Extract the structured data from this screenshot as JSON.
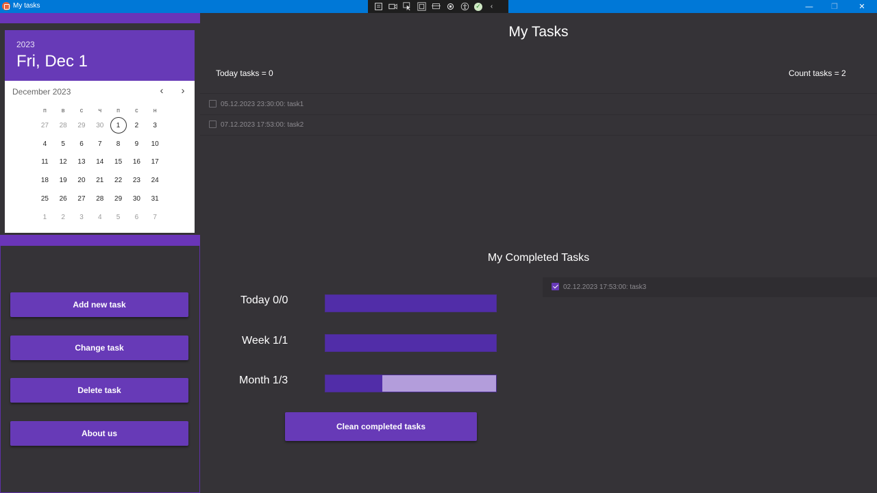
{
  "window": {
    "title": "My tasks",
    "minimize_glyph": "—",
    "maximize_glyph": "❐",
    "close_glyph": "✕"
  },
  "debug_toolbar": {
    "icons": [
      "live-visual-tree-icon",
      "record-icon",
      "select-element-icon",
      "display-layout-adorners-icon",
      "track-focus-icon",
      "hot-reload-icon",
      "accessibility-icon",
      "binding-ok-icon",
      "collapse-toolbar-icon"
    ],
    "ok_glyph": "✓",
    "collapse_glyph": "‹"
  },
  "calendar": {
    "year": "2023",
    "selected_date": "Fri, Dec 1",
    "month_label": "December 2023",
    "prev_glyph": "‹",
    "next_glyph": "›",
    "day_names": [
      "п",
      "в",
      "с",
      "ч",
      "п",
      "с",
      "н"
    ],
    "weeks": [
      [
        "27",
        "28",
        "29",
        "30",
        "1",
        "2",
        "3"
      ],
      [
        "4",
        "5",
        "6",
        "7",
        "8",
        "9",
        "10"
      ],
      [
        "11",
        "12",
        "13",
        "14",
        "15",
        "16",
        "17"
      ],
      [
        "18",
        "19",
        "20",
        "21",
        "22",
        "23",
        "24"
      ],
      [
        "25",
        "26",
        "27",
        "28",
        "29",
        "30",
        "31"
      ],
      [
        "1",
        "2",
        "3",
        "4",
        "5",
        "6",
        "7"
      ]
    ],
    "accent_color": "#673ab7"
  },
  "sidebar": {
    "add_label": "Add new task",
    "change_label": "Change task",
    "delete_label": "Delete task",
    "about_label": "About us"
  },
  "main": {
    "title": "My Tasks",
    "today_tasks": "Today tasks = 0",
    "count_tasks": "Count tasks = 2",
    "tasks": [
      {
        "text": "05.12.2023 23:30:00: task1",
        "done": false
      },
      {
        "text": "07.12.2023 17:53:00: task2",
        "done": false
      }
    ]
  },
  "completed": {
    "title": "My Completed Tasks",
    "tasks": [
      {
        "text": "02.12.2023 17:53:00: task3",
        "done": true
      }
    ]
  },
  "stats": {
    "today_label": "Today  0/0",
    "today_progress": 1.0,
    "week_label": "Week  1/1",
    "week_progress": 1.0,
    "month_label": "Month  1/3",
    "month_progress": 0.333,
    "clean_label": "Clean completed tasks"
  }
}
